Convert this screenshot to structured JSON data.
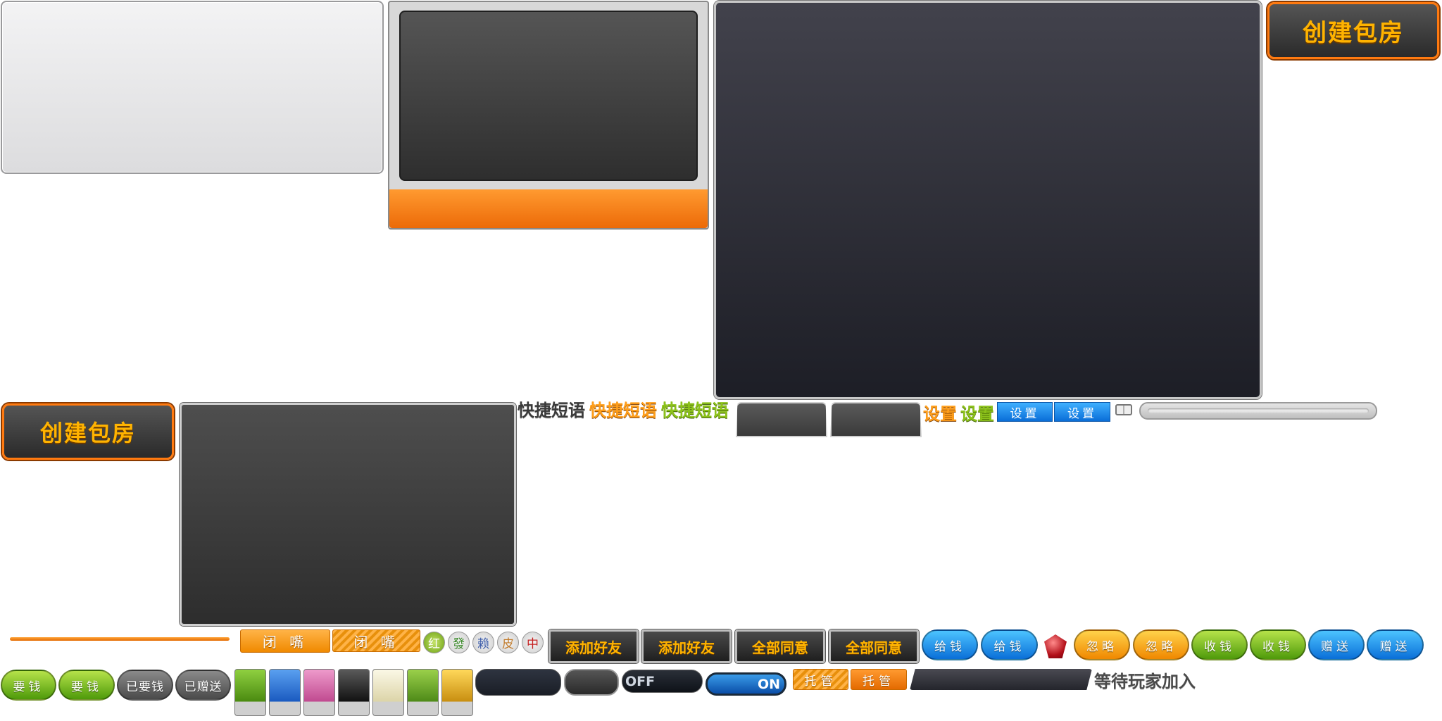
{
  "create_room": {
    "large_label": "创建包房",
    "small_label": "创建包房"
  },
  "quick_phrases": [
    "快捷短语",
    "快捷短语",
    "快捷短语"
  ],
  "settings": {
    "text_a": "设置",
    "text_b": "设置",
    "button_a": "设置",
    "button_b": "设置"
  },
  "mute": {
    "label_a": "闭 嘴",
    "label_b": "闭 嘴"
  },
  "tiles": [
    "红",
    "發",
    "赖",
    "皮",
    "中"
  ],
  "add_friend": [
    "添加好友",
    "添加好友"
  ],
  "agree_all": [
    "全部同意",
    "全部同意"
  ],
  "give_money": [
    "给钱",
    "给钱"
  ],
  "ignore": [
    "忽略",
    "忽略"
  ],
  "collect_money": [
    "收钱",
    "收钱"
  ],
  "gift": [
    "赠送",
    "赠送"
  ],
  "ask_money": [
    "要钱",
    "要钱"
  ],
  "status": {
    "asked": "已要钱",
    "gifted": "已赠送"
  },
  "toggles": {
    "off": "OFF",
    "on": "ON"
  },
  "auto_play": [
    "托管",
    "托管"
  ],
  "waiting_text": "等待玩家加入",
  "colors": {
    "accent_orange": "#ff7a10",
    "gold_text": "#ffb300",
    "blue": "#0a6ed8",
    "green": "#6aae12"
  },
  "swatches": [
    {
      "name": "green",
      "color": "#6aae1a"
    },
    {
      "name": "blue",
      "color": "#2a78d8"
    },
    {
      "name": "pink",
      "color": "#d36aa6"
    },
    {
      "name": "black",
      "color": "#2a2a2a"
    },
    {
      "name": "cream",
      "color": "#ece6c8"
    },
    {
      "name": "lime",
      "color": "#7cbe2a"
    },
    {
      "name": "gold",
      "color": "#e6b420"
    }
  ]
}
